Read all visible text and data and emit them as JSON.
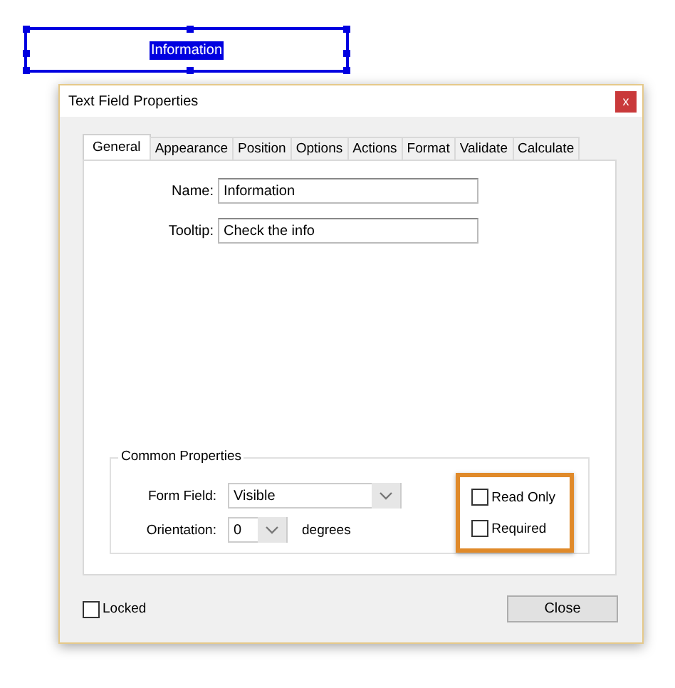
{
  "form_field": {
    "value": "Information",
    "selected": true
  },
  "window": {
    "title": "Text Field Properties",
    "close": "x"
  },
  "tabs": [
    {
      "label": "General",
      "selected": true
    },
    {
      "label": "Appearance",
      "selected": false
    },
    {
      "label": "Position",
      "selected": false
    },
    {
      "label": "Options",
      "selected": false
    },
    {
      "label": "Actions",
      "selected": false
    },
    {
      "label": "Format",
      "selected": false
    },
    {
      "label": "Validate",
      "selected": false
    },
    {
      "label": "Calculate",
      "selected": false
    }
  ],
  "fields": [
    {
      "label": "Name:",
      "value": "Information"
    },
    {
      "label": "Tooltip:",
      "value": "Check the info"
    }
  ],
  "common_properties": {
    "title": "Common Properties",
    "form_field": {
      "label": "Form Field:",
      "value": "Visible"
    },
    "orientation": {
      "label": "Orientation:",
      "value": "0",
      "unit": "degrees"
    },
    "checkboxes": [
      {
        "label": "Read Only",
        "checked": false
      },
      {
        "label": "Required",
        "checked": false
      }
    ],
    "highlighted": true
  },
  "locked": {
    "label": "Locked",
    "checked": false
  },
  "buttons": [
    "Close"
  ]
}
